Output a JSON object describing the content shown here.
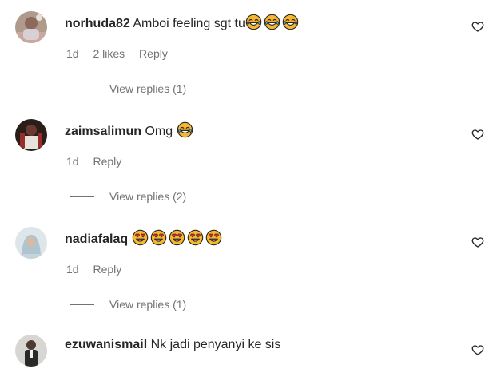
{
  "comments": [
    {
      "username": "norhuda82",
      "text": "Amboi feeling sgt tu",
      "emoji_name": "tears-of-joy-emoji",
      "emoji_count": 3,
      "age": "1d",
      "likes": "2 likes",
      "reply": "Reply",
      "view_replies": "View replies (1)"
    },
    {
      "username": "zaimsalimun",
      "text": "Omg ",
      "emoji_name": "tears-of-joy-emoji",
      "emoji_count": 1,
      "age": "1d",
      "reply": "Reply",
      "view_replies": "View replies (2)"
    },
    {
      "username": "nadiafalaq",
      "text": "",
      "emoji_name": "heart-eyes-emoji",
      "emoji_count": 5,
      "age": "1d",
      "reply": "Reply",
      "view_replies": "View replies (1)"
    },
    {
      "username": "ezuwanismail",
      "text": "Nk jadi penyanyi ke sis"
    }
  ],
  "icons": {
    "like": "heart-outline-icon"
  },
  "colors": {
    "text_primary": "#262626",
    "text_secondary": "#737373",
    "emoji_yellow": "#f7b62b",
    "heart_eyes_red": "#e8263a"
  }
}
